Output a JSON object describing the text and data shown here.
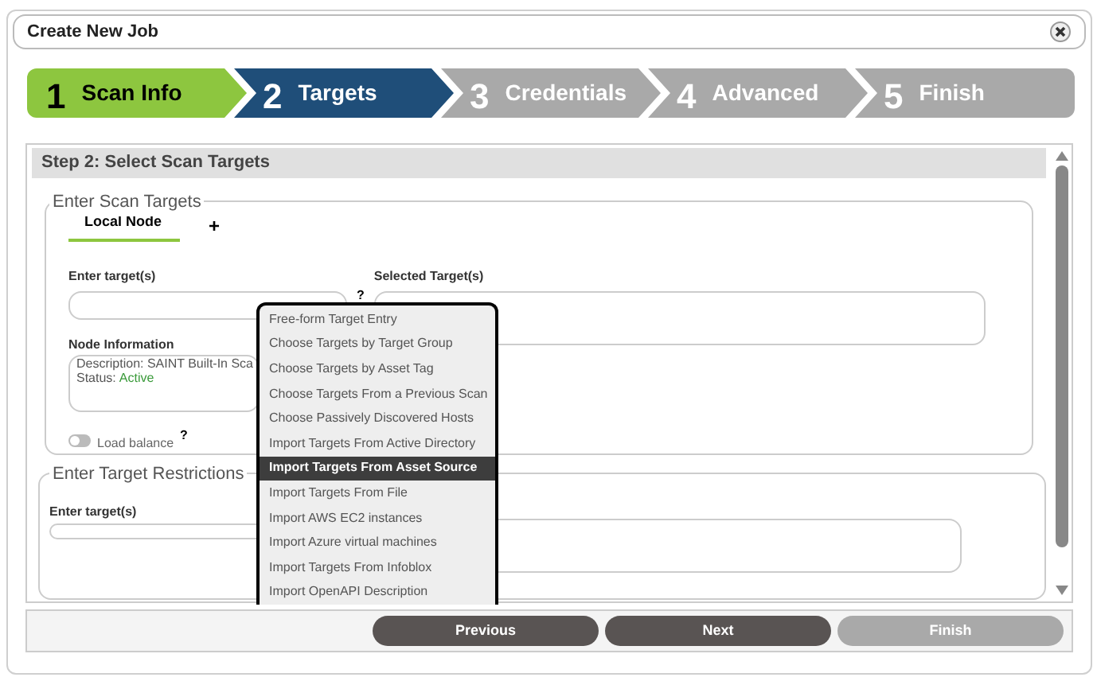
{
  "window": {
    "title": "Create New Job"
  },
  "steps": [
    {
      "number": "1",
      "label": "Scan Info",
      "completed": true,
      "selected": false
    },
    {
      "number": "2",
      "label": "Targets",
      "completed": false,
      "selected": true
    },
    {
      "number": "3",
      "label": "Credentials",
      "completed": false,
      "selected": false
    },
    {
      "number": "4",
      "label": "Advanced",
      "completed": false,
      "selected": false
    },
    {
      "number": "5",
      "label": "Finish",
      "completed": false,
      "selected": false
    }
  ],
  "section_title": "Step 2: Select Scan Targets",
  "scan_targets": {
    "legend": "Enter Scan Targets",
    "tabs": [
      {
        "label": "Local Node",
        "selected": true
      }
    ],
    "add_tab": "+",
    "enter_label": "Enter target(s)",
    "help": "?",
    "selected_label": "Selected Target(s)",
    "node_info_label": "Node Information",
    "node_description": "Description: SAINT Built-In Sca",
    "status_label": "Status:",
    "status_value": "Active",
    "load_balance": {
      "label": "Load balance",
      "on": false,
      "help": "?"
    }
  },
  "restrictions": {
    "legend": "Enter Target Restrictions",
    "enter_label": "Enter target(s)"
  },
  "dropdown": [
    {
      "label": "Free-form Target Entry",
      "selected": false
    },
    {
      "label": "Choose Targets by Target Group",
      "selected": false
    },
    {
      "label": "Choose Targets by Asset Tag",
      "selected": false
    },
    {
      "label": "Choose Targets From a Previous Scan",
      "selected": false
    },
    {
      "label": "Choose Passively Discovered Hosts",
      "selected": false
    },
    {
      "label": "Import Targets From Active Directory",
      "selected": false
    },
    {
      "label": "Import Targets From Asset Source",
      "selected": true
    },
    {
      "label": "Import Targets From File",
      "selected": false
    },
    {
      "label": "Import AWS EC2 instances",
      "selected": false
    },
    {
      "label": "Import Azure virtual machines",
      "selected": false
    },
    {
      "label": "Import Targets From Infoblox",
      "selected": false
    },
    {
      "label": "Import OpenAPI Description",
      "selected": false
    }
  ],
  "buttons": [
    {
      "label": "Previous",
      "disabled": false
    },
    {
      "label": "Next",
      "disabled": false
    },
    {
      "label": "Finish",
      "disabled": true
    }
  ]
}
